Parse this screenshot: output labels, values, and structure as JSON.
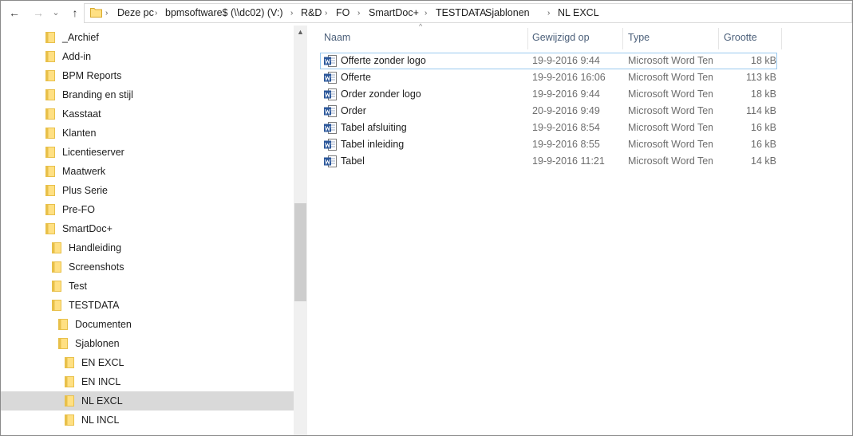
{
  "address_bar": {
    "back_glyph": "←",
    "forward_glyph": "→",
    "history_glyph": "⌄",
    "up_glyph": "↑",
    "separator": "›",
    "crumbs": [
      "Deze pc",
      "bpmsoftware$ (\\\\dc02) (V:)",
      "R&D",
      "FO",
      "SmartDoc+",
      "TESTDATA",
      "Sjablonen",
      "NL EXCL"
    ]
  },
  "nav_tree": {
    "items": [
      {
        "label": "_Archief"
      },
      {
        "label": "Add-in"
      },
      {
        "label": "BPM Reports"
      },
      {
        "label": "Branding en stijl"
      },
      {
        "label": "Kasstaat"
      },
      {
        "label": "Klanten"
      },
      {
        "label": "Licentieserver"
      },
      {
        "label": "Maatwerk"
      },
      {
        "label": "Plus Serie"
      },
      {
        "label": "Pre-FO"
      },
      {
        "label": "SmartDoc+"
      },
      {
        "label": "Handleiding"
      },
      {
        "label": "Screenshots"
      },
      {
        "label": "Test"
      },
      {
        "label": "TESTDATA"
      },
      {
        "label": "Documenten"
      },
      {
        "label": "Sjablonen"
      },
      {
        "label": "EN EXCL"
      },
      {
        "label": "EN INCL"
      },
      {
        "label": "NL EXCL",
        "selected": true
      },
      {
        "label": "NL INCL"
      }
    ]
  },
  "columns": {
    "name": "Naam",
    "date": "Gewijzigd op",
    "type": "Type",
    "size": "Grootte",
    "sort_glyph": "^"
  },
  "files": [
    {
      "name": "Offerte zonder logo",
      "date": "19-9-2016 9:44",
      "type": "Microsoft Word Template",
      "size": "18 kB"
    },
    {
      "name": "Offerte",
      "date": "19-9-2016 16:06",
      "type": "Microsoft Word Template",
      "size": "113 kB"
    },
    {
      "name": "Order zonder logo",
      "date": "19-9-2016 9:44",
      "type": "Microsoft Word Template",
      "size": "18 kB"
    },
    {
      "name": "Order",
      "date": "20-9-2016 9:49",
      "type": "Microsoft Word Template",
      "size": "114 kB"
    },
    {
      "name": "Tabel afsluiting",
      "date": "19-9-2016 8:54",
      "type": "Microsoft Word Template",
      "size": "16 kB"
    },
    {
      "name": "Tabel inleiding",
      "date": "19-9-2016 8:55",
      "type": "Microsoft Word Template",
      "size": "16 kB"
    },
    {
      "name": "Tabel",
      "date": "19-9-2016 11:21",
      "type": "Microsoft Word Template",
      "size": "14 kB"
    }
  ],
  "icons": {
    "folder": "folder-icon",
    "word_template": "word-template-icon"
  },
  "colors": {
    "folder_fill": "#ffe083",
    "folder_tab": "#e8c04a",
    "selection": "#d9d9d9",
    "focus_outline": "#99c9ef",
    "header_text": "#4c607a",
    "word_blue": "#2b579a"
  }
}
